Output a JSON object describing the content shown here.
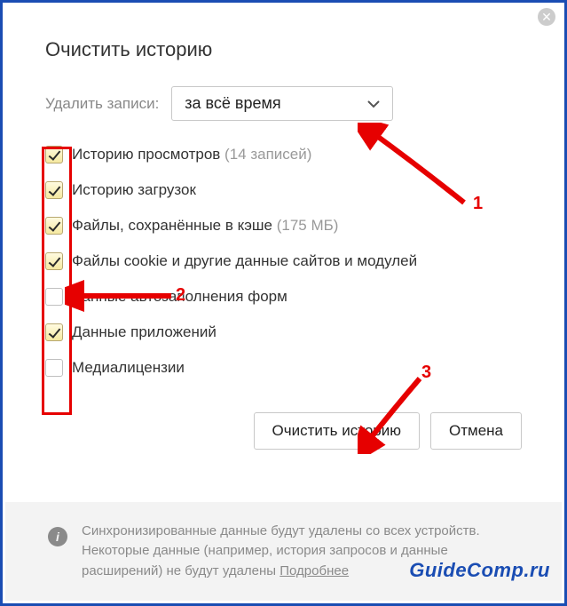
{
  "dialog": {
    "title": "Очистить историю",
    "time_label": "Удалить записи:",
    "time_select": "за всё время",
    "items": [
      {
        "label": "Историю просмотров ",
        "suffix": "(14 записей)",
        "checked": true
      },
      {
        "label": "Историю загрузок",
        "suffix": "",
        "checked": true
      },
      {
        "label": "Файлы, сохранённые в кэше ",
        "suffix": "(175 МБ)",
        "checked": true
      },
      {
        "label": "Файлы cookie и другие данные сайтов и модулей",
        "suffix": "",
        "checked": true
      },
      {
        "label": "Данные автозаполнения форм",
        "suffix": "",
        "checked": false
      },
      {
        "label": "Данные приложений",
        "suffix": "",
        "checked": true
      },
      {
        "label": "Медиалицензии",
        "suffix": "",
        "checked": false
      }
    ],
    "primary_btn": "Очистить историю",
    "cancel_btn": "Отмена",
    "footer_text": "Синхронизированные данные будут удалены со всех устройств. Некоторые данные (например, история запросов и данные расширений) не будут удалены ",
    "footer_link": "Подробнее"
  },
  "annotations": {
    "n1": "1",
    "n2": "2",
    "n3": "3",
    "watermark": "GuideComp.ru"
  }
}
